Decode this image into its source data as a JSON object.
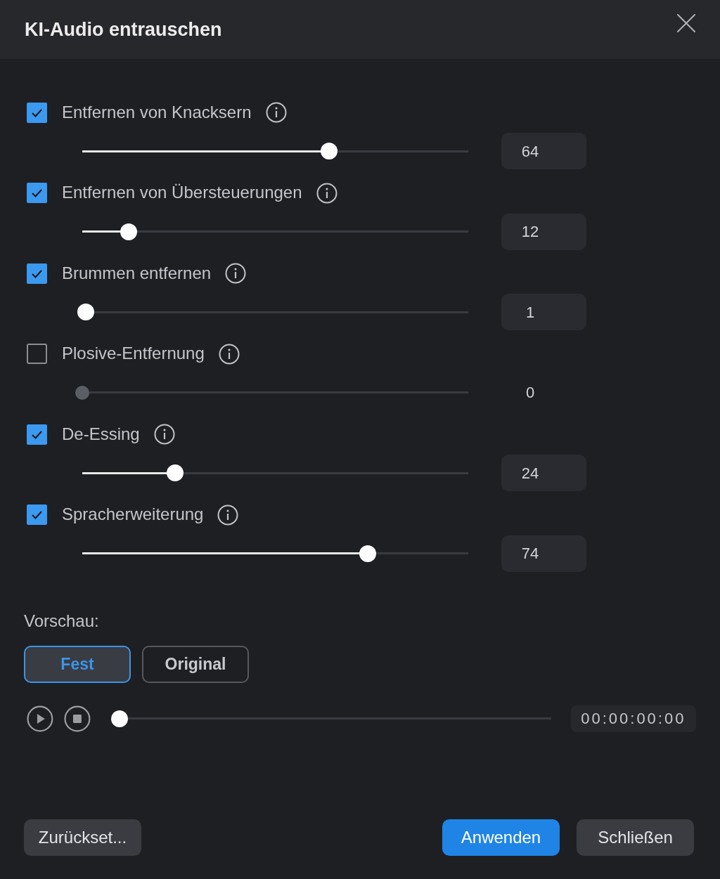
{
  "window": {
    "title": "KI-Audio entrauschen"
  },
  "options": [
    {
      "label": "Entfernen von Knacksern",
      "checked": true,
      "level": 0.64,
      "value": "64"
    },
    {
      "label": "Entfernen von Übersteuerungen",
      "checked": true,
      "level": 0.12,
      "value": "12"
    },
    {
      "label": "Brummen entfernen",
      "checked": true,
      "level": 0.01,
      "value": "1"
    },
    {
      "label": "Plosive-Entfernung",
      "checked": false,
      "level": 0,
      "value": "0"
    },
    {
      "label": "De-Essing",
      "checked": true,
      "level": 0.24,
      "value": "24"
    },
    {
      "label": "Spracherweiterung",
      "checked": true,
      "level": 0.74,
      "value": "74"
    }
  ],
  "preview": {
    "label": "Vorschau:",
    "modes": [
      {
        "label": "Fest",
        "selected": true
      },
      {
        "label": "Original",
        "selected": false
      }
    ]
  },
  "playback": {
    "level": 0,
    "time": "00:00:00:00"
  },
  "buttons": [
    {
      "label": "Zurückset...",
      "kind": "reset"
    },
    {
      "label": "Anwenden",
      "kind": "apply"
    },
    {
      "label": "Schließen",
      "kind": "close"
    }
  ]
}
